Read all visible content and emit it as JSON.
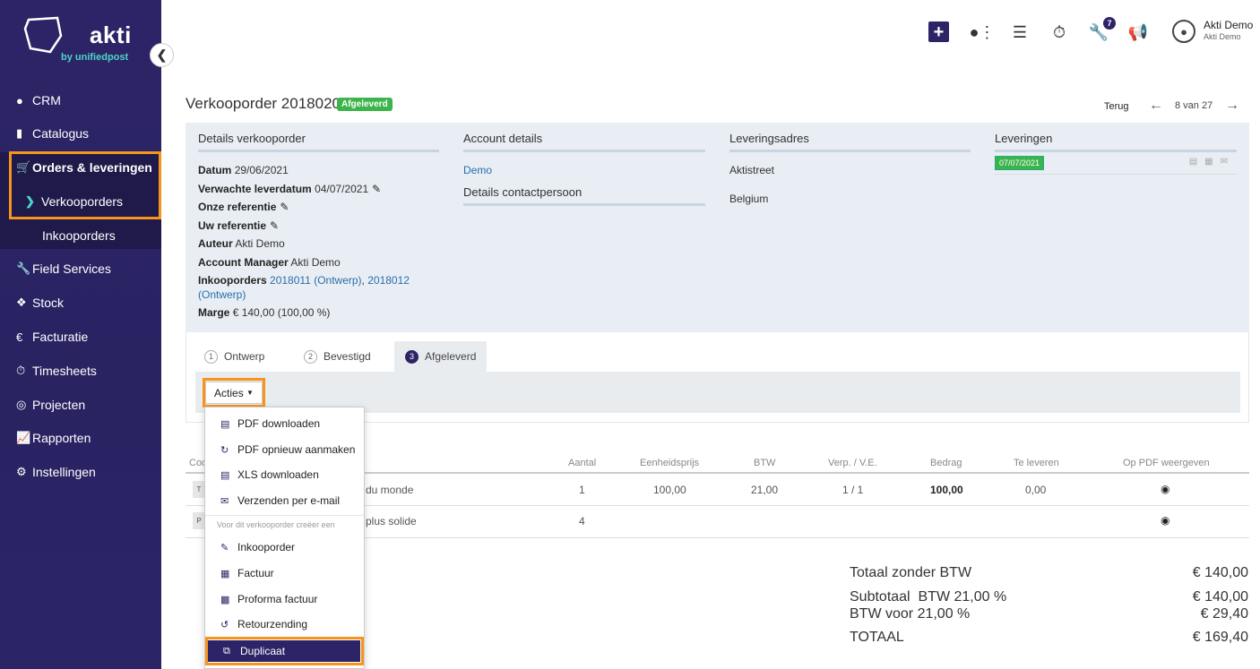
{
  "brand": {
    "name": "akti",
    "sub": "by unifiedpost"
  },
  "sidebar": {
    "items": [
      {
        "label": "CRM",
        "icon": "user-icon"
      },
      {
        "label": "Catalogus",
        "icon": "book-icon"
      },
      {
        "label": "Orders & leveringen",
        "icon": "cart-icon"
      },
      {
        "label": "Verkooporders",
        "icon": "chevron-right-icon"
      },
      {
        "label": "Inkooporders",
        "icon": ""
      },
      {
        "label": "Field Services",
        "icon": "wrench-icon"
      },
      {
        "label": "Stock",
        "icon": "cubes-icon"
      },
      {
        "label": "Facturatie",
        "icon": "euro-icon"
      },
      {
        "label": "Timesheets",
        "icon": "stopwatch-icon"
      },
      {
        "label": "Projecten",
        "icon": "target-icon"
      },
      {
        "label": "Rapporten",
        "icon": "chart-icon"
      },
      {
        "label": "Instellingen",
        "icon": "gear-icon"
      }
    ]
  },
  "topbar": {
    "badge_count": "7",
    "user_name": "Akti Demo",
    "user_sub": "Akti Demo"
  },
  "order": {
    "title": "Verkooporder 2018020",
    "status": "Afgeleverd",
    "back": "Terug",
    "pagination": "8 van 27"
  },
  "details": {
    "heading": "Details verkooporder",
    "datum_label": "Datum",
    "datum": "29/06/2021",
    "lever_label": "Verwachte leverdatum",
    "lever": "04/07/2021",
    "onze_ref": "Onze referentie",
    "uw_ref": "Uw referentie",
    "auteur_label": "Auteur",
    "auteur": "Akti Demo",
    "am_label": "Account Manager",
    "am": "Akti Demo",
    "ink_label": "Inkooporders",
    "ink1": "2018011 (Ontwerp)",
    "ink_sep": ",",
    "ink2": "2018012",
    "ink2b": "(Ontwerp)",
    "marge_label": "Marge",
    "marge": "€ 140,00 (100,00 %)"
  },
  "account": {
    "heading": "Account details",
    "name": "Demo",
    "contact_heading": "Details contactpersoon"
  },
  "levering": {
    "heading": "Leveringsadres",
    "street": "Aktistreet",
    "country": "Belgium"
  },
  "leveringen": {
    "heading": "Leveringen",
    "date": "07/07/2021"
  },
  "tabs": [
    {
      "num": "1",
      "label": "Ontwerp"
    },
    {
      "num": "2",
      "label": "Bevestigd"
    },
    {
      "num": "3",
      "label": "Afgeleverd"
    }
  ],
  "acties": "Acties",
  "table": {
    "headers": [
      "Cod",
      "Aantal",
      "Eenheidsprijs",
      "BTW",
      "Verp. / V.E.",
      "Bedrag",
      "Te leveren",
      "Op PDF weergeven"
    ],
    "rows": [
      {
        "chip": "T",
        "desc": "du monde",
        "aantal": "1",
        "prijs": "100,00",
        "btw": "21,00",
        "verp": "1 / 1",
        "bedrag": "100,00",
        "te": "0,00"
      },
      {
        "chip": "P",
        "desc": "plus solide",
        "aantal": "4"
      }
    ]
  },
  "totals": {
    "zonder_label": "Totaal zonder BTW",
    "zonder": "€ 140,00",
    "sub_label": "Subtotaal  BTW 21,00 %",
    "sub": "€ 140,00",
    "btw_label": "BTW voor 21,00 %",
    "btw": "€ 29,40",
    "totaal_label": "TOTAAL",
    "totaal": "€ 169,40"
  },
  "dropdown": {
    "items1": [
      {
        "label": "PDF downloaden",
        "icon": "pdf-file-icon"
      },
      {
        "label": "PDF opnieuw aanmaken",
        "icon": "refresh-icon"
      },
      {
        "label": "XLS downloaden",
        "icon": "xls-file-icon"
      },
      {
        "label": "Verzenden per e-mail",
        "icon": "envelope-icon"
      }
    ],
    "header": "Voor dit verkooporder creëer een",
    "items2": [
      {
        "label": "Inkooporder",
        "icon": "pencil-icon"
      },
      {
        "label": "Factuur",
        "icon": "invoice-icon"
      },
      {
        "label": "Proforma factuur",
        "icon": "proforma-icon"
      },
      {
        "label": "Retourzending",
        "icon": "undo-icon"
      },
      {
        "label": "Duplicaat",
        "icon": "copy-icon"
      }
    ]
  },
  "colors": {
    "sidebar": "#2c2466",
    "accent": "#f7941d",
    "success": "#3cb44b",
    "link": "#2a6ead"
  }
}
